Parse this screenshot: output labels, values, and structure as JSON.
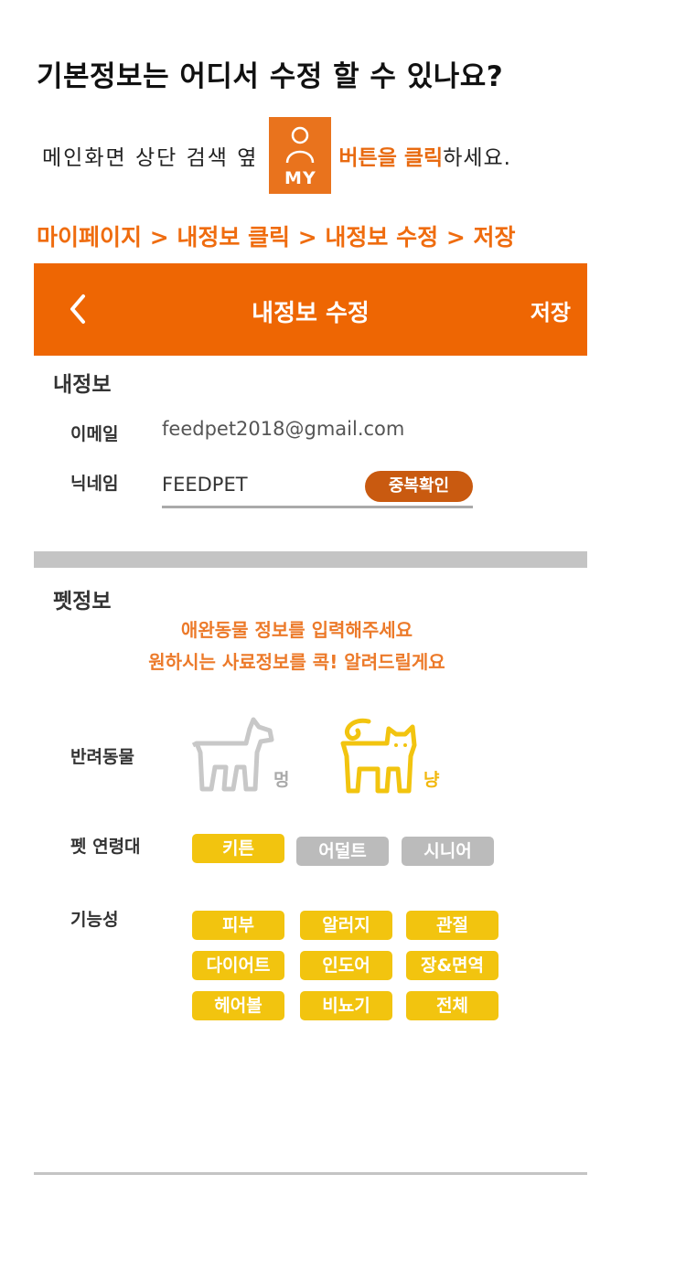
{
  "headline": "기본정보는 어디서 수정 할 수 있나요?",
  "instruction": {
    "before": "메인화면 상단 검색 옆",
    "badge_label": "MY",
    "highlight": "버튼을 클릭",
    "after": "하세요."
  },
  "steps": "마이페이지 > 내정보 클릭 > 내정보 수정 > 저장",
  "appbar": {
    "title": "내정보 수정",
    "save": "저장"
  },
  "my_info": {
    "section_title": "내정보",
    "email_label": "이메일",
    "email_value": "feedpet2018@gmail.com",
    "nickname_label": "닉네임",
    "nickname_value": "FEEDPET",
    "dup_check": "중복확인"
  },
  "pet_info": {
    "section_title": "펫정보",
    "promo_line1": "애완동물 정보를 입력해주세요",
    "promo_line2": "원하시는 사료정보를 콕! 알려드릴게요",
    "pet_label": "반려동물",
    "dog_caption": "멍",
    "cat_caption": "냥",
    "age_label": "펫 연령대",
    "ages": [
      "키튼",
      "어덜트",
      "시니어"
    ],
    "function_label": "기능성",
    "functions": [
      "피부",
      "알러지",
      "관절",
      "다이어트",
      "인도어",
      "장&면역",
      "헤어볼",
      "비뇨기",
      "전체"
    ]
  },
  "colors": {
    "brand_orange": "#ee6603",
    "chip_yellow": "#f2c40f",
    "chip_gray": "#bbbbbb",
    "cat_yellow": "#f2c40f",
    "dog_gray": "#c8c8c8"
  },
  "selected": {
    "pet": "cat",
    "age": "키튼"
  }
}
